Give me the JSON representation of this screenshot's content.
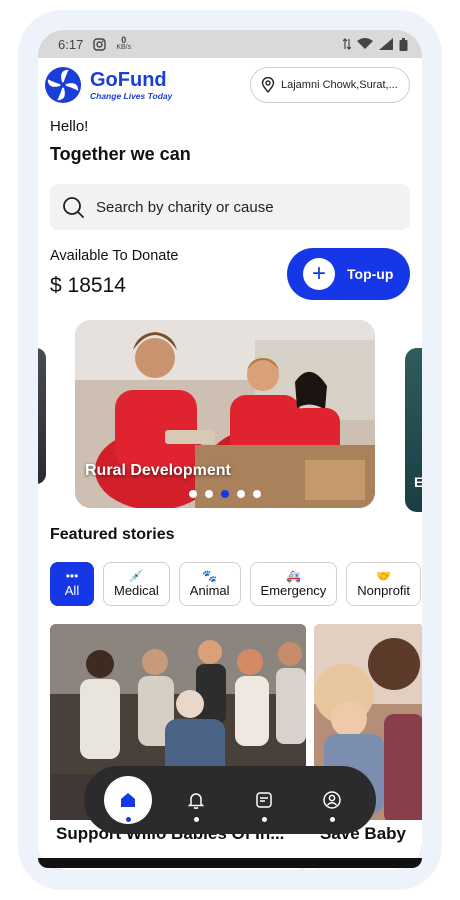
{
  "status_bar": {
    "time": "6:17",
    "data_rate": "0",
    "data_unit": "KB/s"
  },
  "header": {
    "brand_name": "GoFund",
    "brand_tagline": "Change Lives Today",
    "location": "Lajamni Chowk,Surat,..."
  },
  "greeting": {
    "hello": "Hello!",
    "tagline": "Together we can"
  },
  "search": {
    "placeholder": "Search by charity or cause"
  },
  "wallet": {
    "label": "Available To Donate",
    "amount": "$ 18514",
    "topup_label": "Top-up"
  },
  "carousel": {
    "slides": [
      {
        "title": "Rural Development"
      },
      {
        "title": "E"
      }
    ],
    "dots": 5,
    "active_dot": 2
  },
  "featured": {
    "title": "Featured stories"
  },
  "categories": [
    {
      "label": "All",
      "icon": "more-dots-icon",
      "active": true
    },
    {
      "label": "Medical",
      "icon": "syringe-icon"
    },
    {
      "label": "Animal",
      "icon": "paw-icon"
    },
    {
      "label": "Emergency",
      "icon": "ambulance-icon"
    },
    {
      "label": "Nonprofit",
      "icon": "handshake-icon"
    }
  ],
  "stories": [
    {
      "caption": "Support Willo Babies Of In..."
    },
    {
      "caption": "Save Baby"
    }
  ],
  "bottom_nav": [
    {
      "name": "home",
      "icon": "home-icon",
      "active": true
    },
    {
      "name": "notifications",
      "icon": "bell-icon"
    },
    {
      "name": "notes",
      "icon": "note-icon"
    },
    {
      "name": "profile",
      "icon": "user-icon"
    }
  ],
  "colors": {
    "accent": "#1537e8",
    "brand": "#1a3fd8",
    "nav_bg": "#2b2b2d"
  }
}
